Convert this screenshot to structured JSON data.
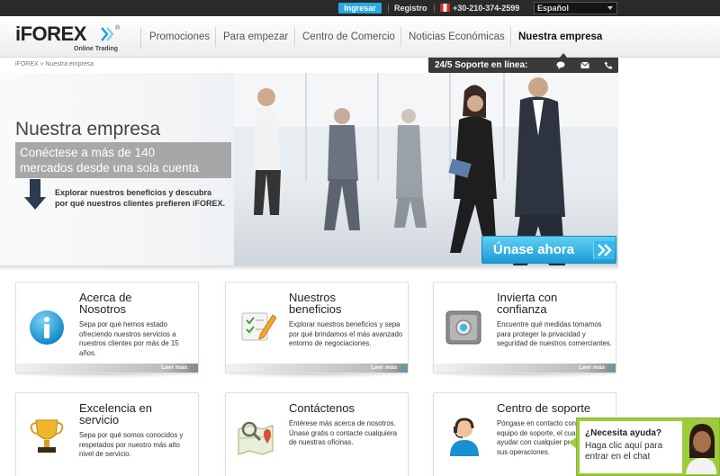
{
  "topbar": {
    "login_label": "Ingresar",
    "register_label": "Registro",
    "phone": "+30-210-374-2599",
    "language": "Español"
  },
  "header": {
    "logo_text": "iFOREX",
    "logo_reg": "®",
    "logo_subtitle": "Online Trading",
    "nav": [
      {
        "label": "Promociones"
      },
      {
        "label": "Para empezar"
      },
      {
        "label": "Centro de Comercio"
      },
      {
        "label": "Noticias Económicas"
      },
      {
        "label": "Nuestra empresa",
        "active": true
      }
    ]
  },
  "breadcrumb": "iFOREX » Nuestra empresa",
  "support": {
    "label": "24/5 Soporte en línea:",
    "icons": [
      "chat-bubble-icon",
      "mail-icon",
      "phone-icon"
    ]
  },
  "hero": {
    "title": "Nuestra empresa",
    "tagline_line1": "Conéctese a más de 140",
    "tagline_line2": "mercados desde una sola cuenta",
    "explore_line1": "Explorar nuestros beneficios y descubra",
    "explore_line2": "por qué nuestros clientes prefieren iFOREX.",
    "join_label": "Únase ahora"
  },
  "cards": [
    {
      "title_line1": "Acerca de",
      "title_line2": "Nosotros",
      "text": "Sepa por qué hemos estado ofreciendo nuestros servicios a nuestros clientes por más de 15 años.",
      "more": "Leer más",
      "icon": "info-icon"
    },
    {
      "title_line1": "Nuestros",
      "title_line2": "beneficios",
      "text": "Explorar nuestros beneficios y sepa por qué brindamos el más avanzado entorno de negociaciones.",
      "more": "Leer más",
      "icon": "checklist-pencil-icon"
    },
    {
      "title_line1": "Invierta con",
      "title_line2": "confianza",
      "text": "Encuentre qué medidas tomamos para proteger la privacidad y seguridad de nuestros comerciantes.",
      "more": "Leer más",
      "icon": "safe-icon"
    },
    {
      "title_line1": "Excelencia en",
      "title_line2": "servicio",
      "text": "Sepa por qué somos conocidos y respetados por nuestro más alto nivel de servicio.",
      "icon": "trophy-icon"
    },
    {
      "title_line1": "Contáctenos",
      "title_line2": "",
      "text": "Entérese más acerca de nosotros. Únase gratis o contacte cualquiera de nuestras oficinas.",
      "icon": "map-pin-icon"
    },
    {
      "title_line1": "Centro de soporte",
      "title_line2": "",
      "text": "Póngase en contacto con nuestro equipo de soporte, el cual le podrá ayudar con cualquier problema en sus operaciones.",
      "icon": "support-agent-icon"
    }
  ],
  "chat": {
    "title": "¿Necesita ayuda?",
    "text": "Haga clic aquí para entrar en el chat"
  }
}
